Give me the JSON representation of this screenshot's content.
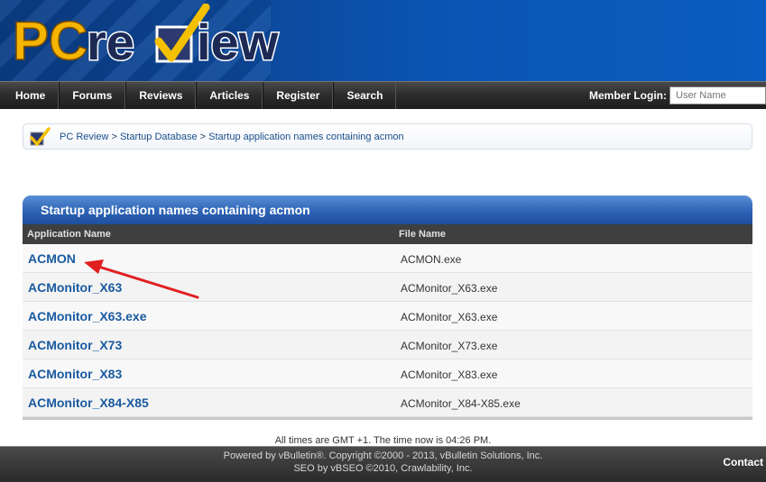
{
  "logo": {
    "part1": "PC",
    "part2": "re",
    "part3": "iew"
  },
  "nav": {
    "items": [
      "Home",
      "Forums",
      "Reviews",
      "Articles",
      "Register",
      "Search"
    ],
    "member_login_label": "Member Login:",
    "username_placeholder": "User Name"
  },
  "breadcrumb": {
    "site": "PC Review",
    "section": "Startup Database",
    "current": "Startup application names containing acmon",
    "separator": " > "
  },
  "table": {
    "title": "Startup application names containing acmon",
    "columns": [
      "Application Name",
      "File Name"
    ],
    "rows": [
      {
        "app": "ACMON",
        "file": "ACMON.exe"
      },
      {
        "app": "ACMonitor_X63",
        "file": "ACMonitor_X63.exe"
      },
      {
        "app": "ACMonitor_X63.exe",
        "file": "ACMonitor_X63.exe"
      },
      {
        "app": "ACMonitor_X73",
        "file": "ACMonitor_X73.exe"
      },
      {
        "app": "ACMonitor_X83",
        "file": "ACMonitor_X83.exe"
      },
      {
        "app": "ACMonitor_X84-X85",
        "file": "ACMonitor_X84-X85.exe"
      }
    ]
  },
  "footer": {
    "time_note": "All times are GMT +1. The time now is 04:26 PM.",
    "powered": "Powered by vBulletin®. Copyright ©2000 - 2013, vBulletin Solutions, Inc.",
    "seo": "SEO by vBSEO ©2010, Crawlability, Inc.",
    "contact": "Contact"
  },
  "colors": {
    "accent_blue": "#1a5aa0",
    "header_blue": "#0c4a9e",
    "arrow_red": "#e02020"
  }
}
